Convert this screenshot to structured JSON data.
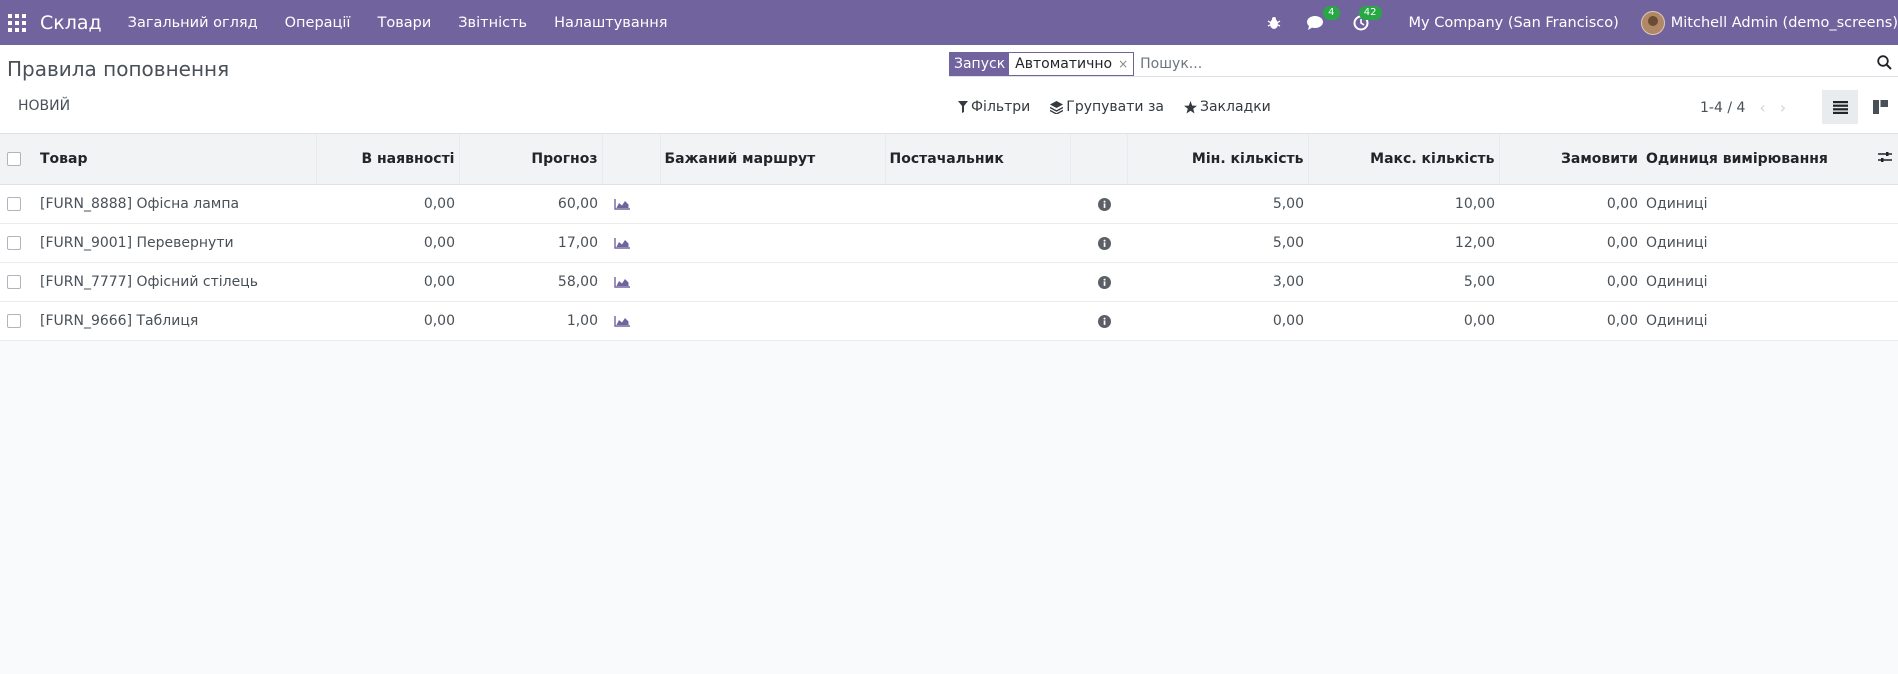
{
  "navbar": {
    "app_name": "Склад",
    "menu": [
      "Загальний огляд",
      "Операції",
      "Товари",
      "Звітність",
      "Налаштування"
    ],
    "messages_count": "4",
    "activities_count": "42",
    "company": "My Company (San Francisco)",
    "user": "Mitchell Admin (demo_screens)"
  },
  "control": {
    "title": "Правила поповнення",
    "new_button": "НОВИЙ",
    "facet_label": "Запуск",
    "facet_value": "Автоматично",
    "facet_remove": "×",
    "search_placeholder": "Пошук...",
    "filters": "Фільтри",
    "group_by": "Групувати за",
    "favorites": "Закладки",
    "pager": "1-4 / 4"
  },
  "table": {
    "columns": [
      "Товар",
      "В наявності",
      "Прогноз",
      "",
      "Бажаний маршрут",
      "Постачальник",
      "",
      "Мін. кількість",
      "Макс. кількість",
      "Замовити",
      "Одиниця вимірювання"
    ],
    "rows": [
      {
        "product": "[FURN_8888] Офісна лампа",
        "on_hand": "0,00",
        "forecast": "60,00",
        "min": "5,00",
        "max": "10,00",
        "order": "0,00",
        "uom": "Одиниці"
      },
      {
        "product": "[FURN_9001] Перевернути",
        "on_hand": "0,00",
        "forecast": "17,00",
        "min": "5,00",
        "max": "12,00",
        "order": "0,00",
        "uom": "Одиниці"
      },
      {
        "product": "[FURN_7777] Офісний стілець",
        "on_hand": "0,00",
        "forecast": "58,00",
        "min": "3,00",
        "max": "5,00",
        "order": "0,00",
        "uom": "Одиниці"
      },
      {
        "product": "[FURN_9666] Таблиця",
        "on_hand": "0,00",
        "forecast": "1,00",
        "min": "0,00",
        "max": "0,00",
        "order": "0,00",
        "uom": "Одиниці"
      }
    ]
  },
  "colors": {
    "brand": "#71639e",
    "badge": "#28a745"
  },
  "icons": [
    "apps-grid-icon",
    "bug-icon",
    "chat-icon",
    "clock-icon",
    "search-icon",
    "filter-icon",
    "layers-icon",
    "star-icon",
    "list-view-icon",
    "kanban-view-icon",
    "chart-area-icon",
    "info-icon",
    "column-settings-icon"
  ]
}
